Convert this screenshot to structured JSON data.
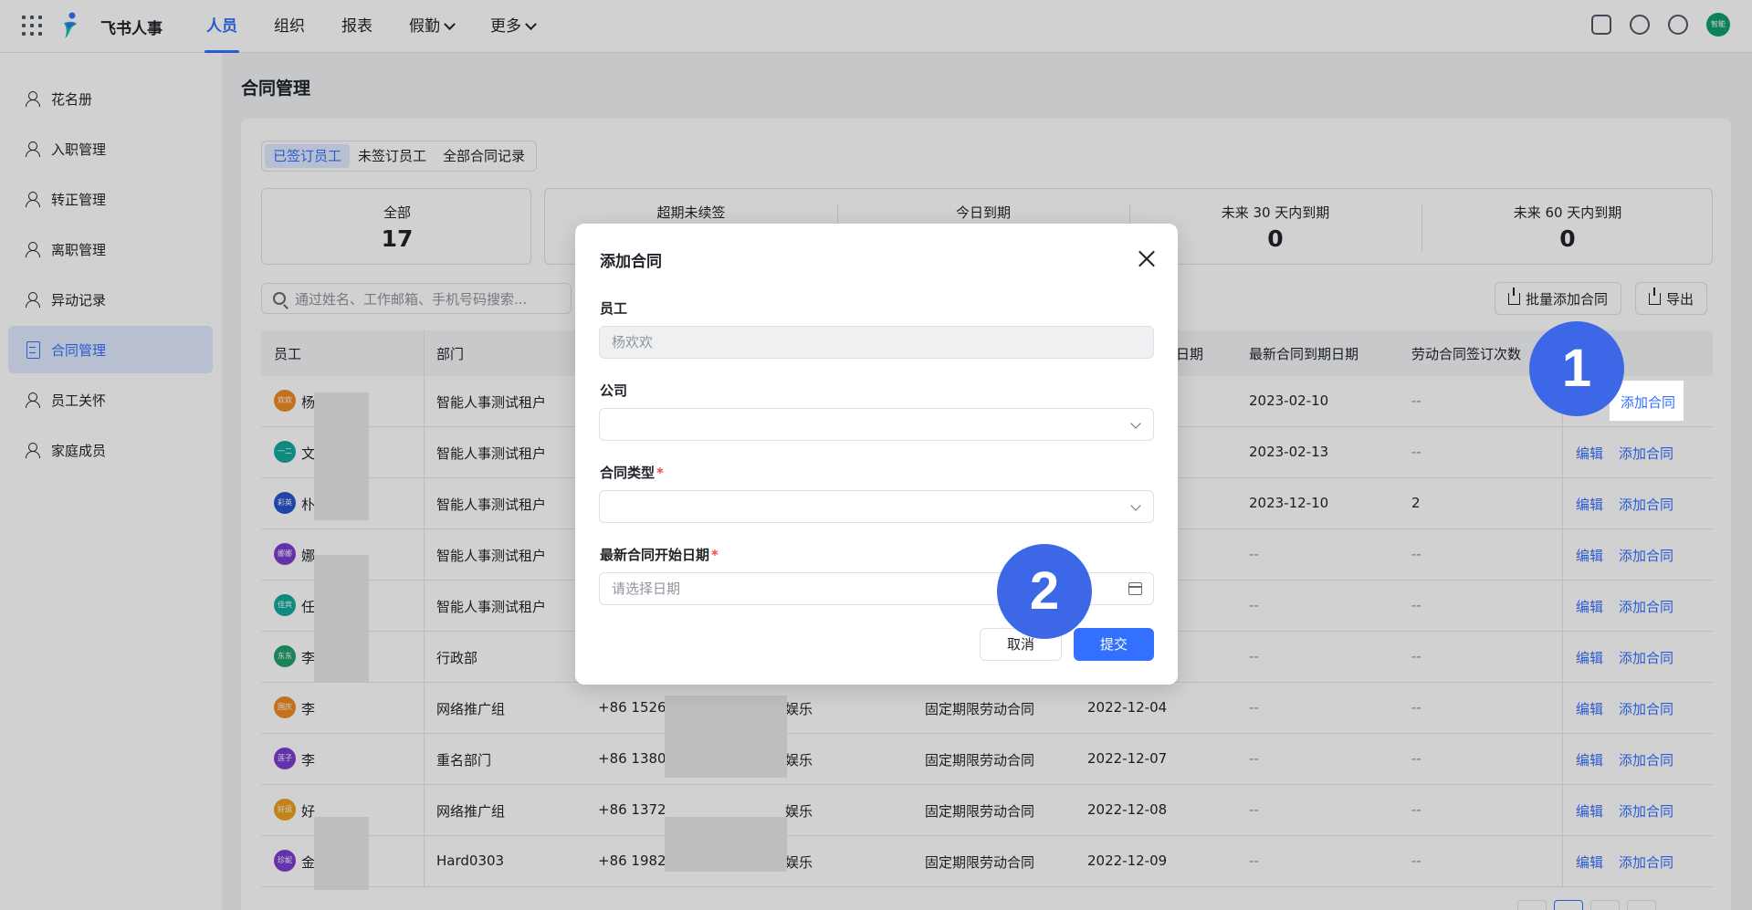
{
  "app": {
    "brand": "飞书人事"
  },
  "nav": {
    "items": [
      {
        "label": "人员",
        "active": true,
        "dropdown": false
      },
      {
        "label": "组织",
        "active": false,
        "dropdown": false
      },
      {
        "label": "报表",
        "active": false,
        "dropdown": false
      },
      {
        "label": "假勤",
        "active": false,
        "dropdown": true
      },
      {
        "label": "更多",
        "active": false,
        "dropdown": true
      }
    ]
  },
  "user": {
    "avatar_text": "智能"
  },
  "sidebar": {
    "items": [
      {
        "label": "花名册",
        "active": false
      },
      {
        "label": "入职管理",
        "active": false
      },
      {
        "label": "转正管理",
        "active": false
      },
      {
        "label": "离职管理",
        "active": false
      },
      {
        "label": "异动记录",
        "active": false
      },
      {
        "label": "合同管理",
        "active": true
      },
      {
        "label": "员工关怀",
        "active": false
      },
      {
        "label": "家庭成员",
        "active": false
      }
    ]
  },
  "page": {
    "title": "合同管理"
  },
  "tabs": [
    {
      "label": "已签订员工",
      "active": true
    },
    {
      "label": "未签订员工",
      "active": false
    },
    {
      "label": "全部合同记录",
      "active": false
    }
  ],
  "stats": [
    {
      "label": "全部",
      "value": "17"
    },
    {
      "label": "超期未续签",
      "value": ""
    },
    {
      "label": "今日到期",
      "value": ""
    },
    {
      "label": "未来 30 天内到期",
      "value": "0"
    },
    {
      "label": "未来 60 天内到期",
      "value": "0"
    }
  ],
  "toolbar": {
    "search_placeholder": "通过姓名、工作邮箱、手机号码搜索...",
    "batch_add_label": "批量添加合同",
    "export_label": "导出"
  },
  "table": {
    "columns": [
      "员工",
      "部门",
      "日期",
      "最新合同到期日期",
      "劳动合同签订次数"
    ],
    "rows": [
      {
        "avatar": "欢欢",
        "color": "#f08a24",
        "initial": "杨",
        "dept": "智能人事测试租户",
        "phone": "",
        "entity": "",
        "type": "",
        "start": "",
        "end": "2023-02-10",
        "count": "--",
        "edit": "",
        "add": "添加合同"
      },
      {
        "avatar": "一二",
        "color": "#14a99b",
        "initial": "文",
        "dept": "智能人事测试租户",
        "phone": "",
        "entity": "",
        "type": "",
        "start": "",
        "end": "2023-02-13",
        "count": "--",
        "edit": "编辑",
        "add": "添加合同"
      },
      {
        "avatar": "彩英",
        "color": "#2955cc",
        "initial": "朴",
        "dept": "智能人事测试租户",
        "phone": "",
        "entity": "",
        "type": "",
        "start": "",
        "end": "2023-12-10",
        "count": "2",
        "edit": "编辑",
        "add": "添加合同"
      },
      {
        "avatar": "娜娜",
        "color": "#7b3fd1",
        "initial": "娜",
        "dept": "智能人事测试租户",
        "phone": "",
        "entity": "",
        "type": "",
        "start": "",
        "end": "--",
        "count": "--",
        "edit": "编辑",
        "add": "添加合同"
      },
      {
        "avatar": "佳宾",
        "color": "#14a99b",
        "initial": "任",
        "dept": "智能人事测试租户",
        "phone": "",
        "entity": "",
        "type": "",
        "start": "",
        "end": "--",
        "count": "--",
        "edit": "编辑",
        "add": "添加合同"
      },
      {
        "avatar": "东东",
        "color": "#22a06b",
        "initial": "李",
        "dept": "行政部",
        "phone": "",
        "entity": "",
        "type": "",
        "start": "",
        "end": "--",
        "count": "--",
        "edit": "编辑",
        "add": "添加合同"
      },
      {
        "avatar": "国庆",
        "color": "#f08a24",
        "initial": "李",
        "dept": "网络推广组",
        "phone": "+86 1526",
        "entity": "娱乐",
        "type": "固定期限劳动合同",
        "start": "2022-12-04",
        "end": "--",
        "count": "--",
        "edit": "编辑",
        "add": "添加合同"
      },
      {
        "avatar": "莲子",
        "color": "#7b3fd1",
        "initial": "李",
        "dept": "重名部门",
        "phone": "+86 1380",
        "entity": "娱乐",
        "type": "固定期限劳动合同",
        "start": "2022-12-07",
        "end": "--",
        "count": "--",
        "edit": "编辑",
        "add": "添加合同"
      },
      {
        "avatar": "好运",
        "color": "#f0a020",
        "initial": "好",
        "dept": "网络推广组",
        "phone": "+86 1372",
        "entity": "娱乐",
        "type": "固定期限劳动合同",
        "start": "2022-12-08",
        "end": "--",
        "count": "--",
        "edit": "编辑",
        "add": "添加合同"
      },
      {
        "avatar": "珍妮",
        "color": "#7b3fd1",
        "initial": "金",
        "dept": "Hard0303",
        "phone": "+86 1982",
        "entity": "娱乐",
        "type": "固定期限劳动合同",
        "start": "2022-12-09",
        "end": "--",
        "count": "--",
        "edit": "编辑",
        "add": "添加合同"
      }
    ]
  },
  "dialog": {
    "title": "添加合同",
    "employee_label": "员工",
    "employee_value": "杨欢欢",
    "company_label": "公司",
    "company_value": "",
    "contract_type_label": "合同类型",
    "start_date_label": "最新合同开始日期",
    "start_date_placeholder": "请选择日期",
    "cancel_label": "取消",
    "submit_label": "提交"
  },
  "annotations": [
    {
      "number": "1"
    },
    {
      "number": "2"
    }
  ],
  "colors": {
    "accent": "#3370ff",
    "badge": "#3c68e8",
    "required": "#f54a45"
  }
}
